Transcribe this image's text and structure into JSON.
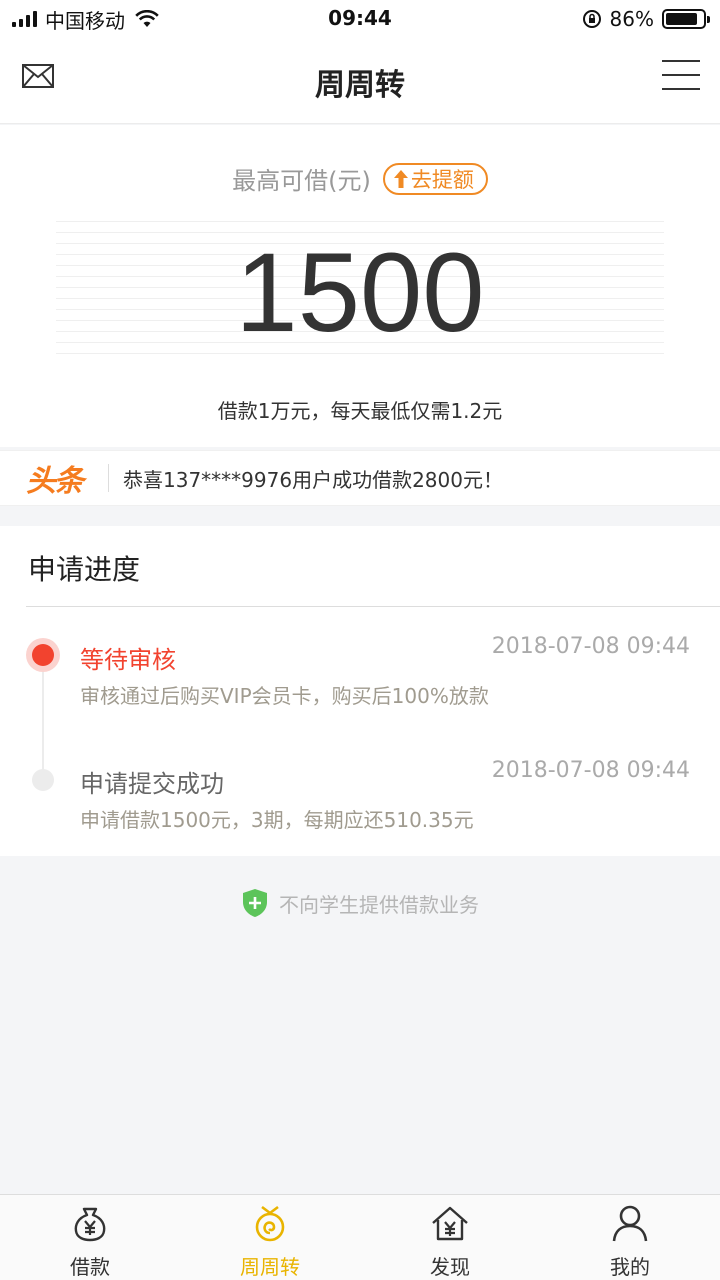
{
  "status_bar": {
    "carrier": "中国移动",
    "time": "09:44",
    "battery": "86%",
    "battery_level": 0.86
  },
  "nav": {
    "title": "周周转"
  },
  "quota": {
    "label": "最高可借(元)",
    "raise_button": "去提额",
    "amount": "1500",
    "note": "借款1万元，每天最低仅需1.2元"
  },
  "headline": {
    "logo": "头条",
    "text": "恭喜137****9976用户成功借款2800元！"
  },
  "progress": {
    "title": "申请进度",
    "steps": [
      {
        "title": "等待审核",
        "time": "2018-07-08 09:44",
        "desc": "审核通过后购买VIP会员卡，购买后100%放款"
      },
      {
        "title": "申请提交成功",
        "time": "2018-07-08 09:44",
        "desc": "申请借款1500元，3期，每期应还510.35元"
      }
    ]
  },
  "notice": {
    "text": "不向学生提供借款业务"
  },
  "tabbar": {
    "tabs": [
      {
        "label": "借款",
        "icon": "money-bag-icon"
      },
      {
        "label": "周周转",
        "icon": "swirl-icon"
      },
      {
        "label": "发现",
        "icon": "house-yen-icon"
      },
      {
        "label": "我的",
        "icon": "person-icon"
      }
    ],
    "active_index": 1
  },
  "colors": {
    "accent": "#f2432f",
    "orange": "#f08a24",
    "tab_active": "#e9b400",
    "shield": "#5cc45a"
  }
}
